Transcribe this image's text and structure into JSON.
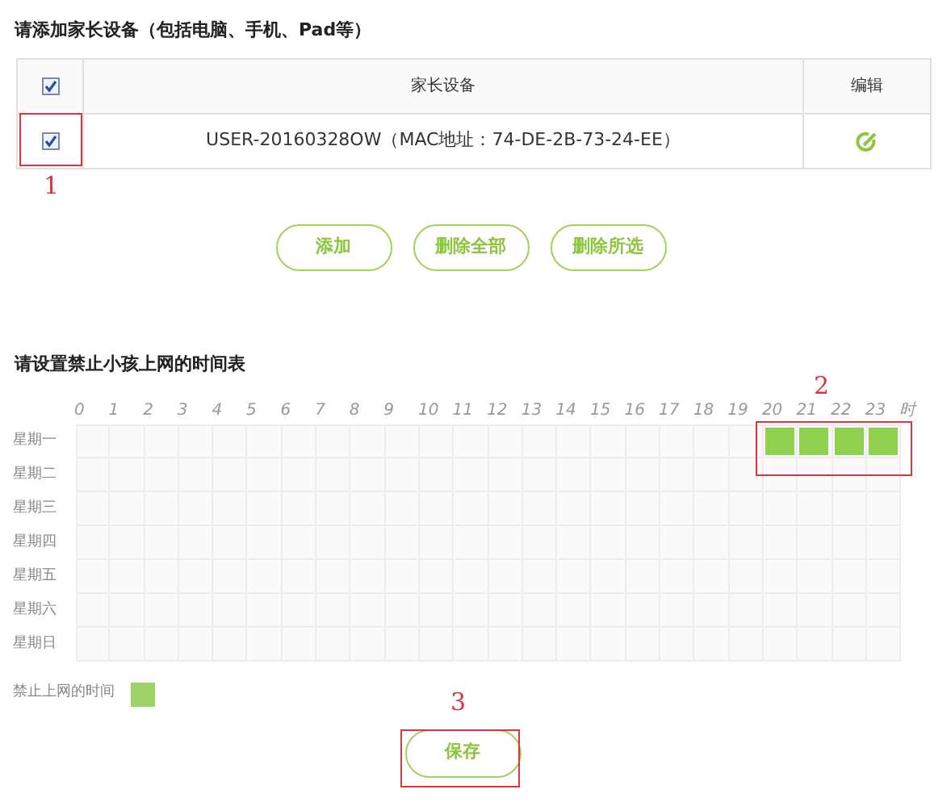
{
  "devices_section": {
    "title": "请添加家长设备（包括电脑、手机、Pad等）",
    "table": {
      "header_checked": true,
      "columns": [
        "家长设备",
        "编辑"
      ],
      "rows": [
        {
          "checked": true,
          "device": "USER-20160328OW（MAC地址：74-DE-2B-73-24-EE）"
        }
      ]
    },
    "buttons": [
      "添加",
      "删除全部",
      "删除所选"
    ]
  },
  "schedule": {
    "title": "请设置禁止小孩上网的时间表",
    "hours": [
      "0",
      "1",
      "2",
      "3",
      "4",
      "5",
      "6",
      "7",
      "8",
      "9",
      "10",
      "11",
      "12",
      "13",
      "14",
      "15",
      "16",
      "17",
      "18",
      "19",
      "20",
      "21",
      "22",
      "23",
      "时"
    ],
    "days": [
      {
        "label": "星期一",
        "blocked": [
          false,
          false,
          false,
          false,
          false,
          false,
          false,
          false,
          false,
          false,
          false,
          false,
          false,
          false,
          false,
          false,
          false,
          false,
          false,
          false,
          true,
          true,
          true,
          true
        ]
      },
      {
        "label": "星期二",
        "blocked": [
          false,
          false,
          false,
          false,
          false,
          false,
          false,
          false,
          false,
          false,
          false,
          false,
          false,
          false,
          false,
          false,
          false,
          false,
          false,
          false,
          false,
          false,
          false,
          false
        ]
      },
      {
        "label": "星期三",
        "blocked": [
          false,
          false,
          false,
          false,
          false,
          false,
          false,
          false,
          false,
          false,
          false,
          false,
          false,
          false,
          false,
          false,
          false,
          false,
          false,
          false,
          false,
          false,
          false,
          false
        ]
      },
      {
        "label": "星期四",
        "blocked": [
          false,
          false,
          false,
          false,
          false,
          false,
          false,
          false,
          false,
          false,
          false,
          false,
          false,
          false,
          false,
          false,
          false,
          false,
          false,
          false,
          false,
          false,
          false,
          false
        ]
      },
      {
        "label": "星期五",
        "blocked": [
          false,
          false,
          false,
          false,
          false,
          false,
          false,
          false,
          false,
          false,
          false,
          false,
          false,
          false,
          false,
          false,
          false,
          false,
          false,
          false,
          false,
          false,
          false,
          false
        ]
      },
      {
        "label": "星期六",
        "blocked": [
          false,
          false,
          false,
          false,
          false,
          false,
          false,
          false,
          false,
          false,
          false,
          false,
          false,
          false,
          false,
          false,
          false,
          false,
          false,
          false,
          false,
          false,
          false,
          false
        ]
      },
      {
        "label": "星期日",
        "blocked": [
          false,
          false,
          false,
          false,
          false,
          false,
          false,
          false,
          false,
          false,
          false,
          false,
          false,
          false,
          false,
          false,
          false,
          false,
          false,
          false,
          false,
          false,
          false,
          false
        ]
      }
    ],
    "legend": "禁止上网的时间",
    "save_button": "保存"
  },
  "annotations": [
    "1",
    "2",
    "3"
  ]
}
